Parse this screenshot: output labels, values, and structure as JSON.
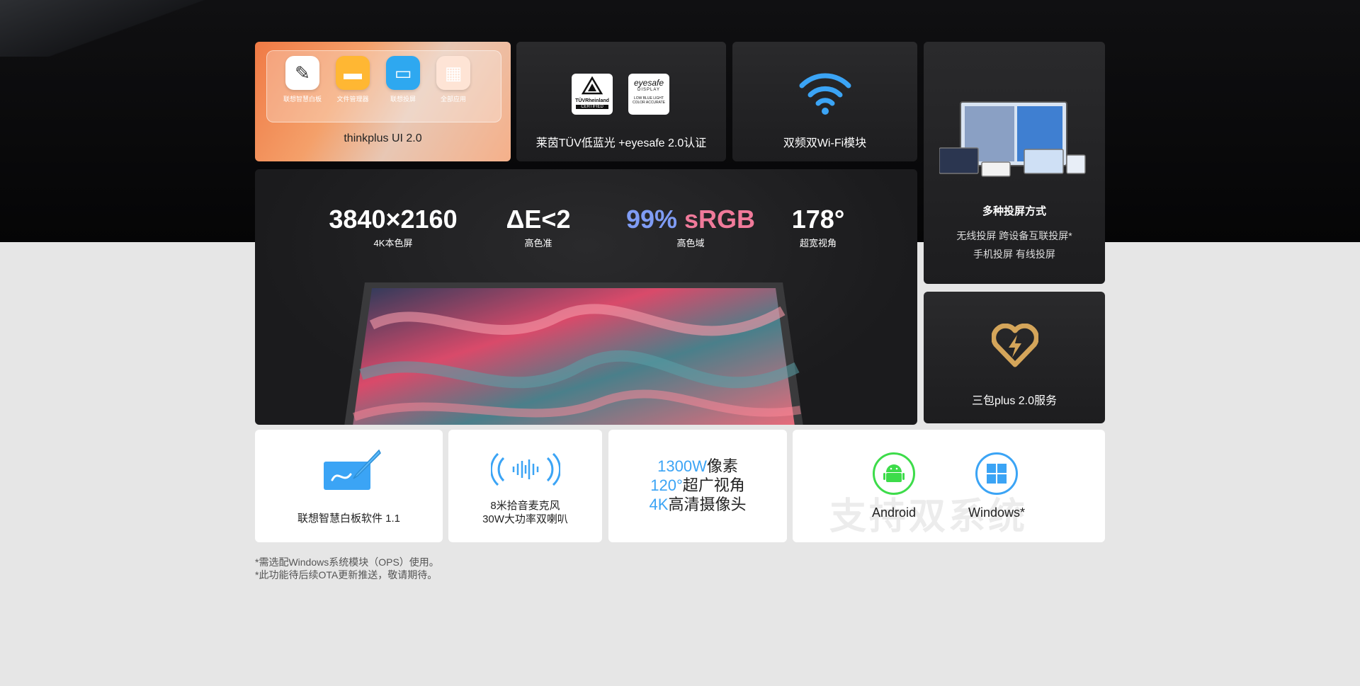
{
  "ui_card": {
    "apps": [
      {
        "label": "联想智慧白板",
        "icon": "pen-icon",
        "color": "#ffffff"
      },
      {
        "label": "文件管理器",
        "icon": "folder-icon",
        "color": "#ffb733"
      },
      {
        "label": "联想投屏",
        "icon": "cast-icon",
        "color": "#2ea8f0"
      },
      {
        "label": "全部应用",
        "icon": "apps-grid-icon",
        "color": "#ffd6c2"
      }
    ],
    "title": "thinkplus UI 2.0"
  },
  "cert_card": {
    "tuv_lines": [
      "TÜVRheinland",
      "CERTIFIED"
    ],
    "eyesafe_lines": [
      "eyesafe",
      "DISPLAY",
      "LOW BLUE LIGHT",
      "COLOR ACCURATE"
    ],
    "caption": "莱茵TÜV低蓝光 +eyesafe 2.0认证"
  },
  "wifi_card": {
    "caption": "双频双Wi-Fi模块",
    "accent": "#3ba4f5"
  },
  "projection_card": {
    "title": "多种投屏方式",
    "line1": "无线投屏 跨设备互联投屏*",
    "line2": "手机投屏 有线投屏"
  },
  "service_card": {
    "caption": "三包plus 2.0服务",
    "accent": "#d4a55a"
  },
  "specs": [
    {
      "value": "3840×2160",
      "label": "4K本色屏"
    },
    {
      "value": "ΔE<2",
      "label": "高色准"
    },
    {
      "value_a": "99%",
      "value_b": "sRGB",
      "label": "高色域"
    },
    {
      "value": "178°",
      "label": "超宽视角"
    }
  ],
  "features": {
    "whiteboard": "联想智慧白板软件 1.1",
    "mic_line1": "8米拾音麦克风",
    "mic_line2": "30W大功率双喇叭",
    "camera": [
      {
        "accent": "1300W",
        "text": "像素"
      },
      {
        "accent": "120°",
        "text": "超广视角"
      },
      {
        "accent": "4K",
        "text": "高清摄像头"
      }
    ],
    "dual_system_bg": "支持双系统",
    "android": "Android",
    "windows": "Windows*"
  },
  "footnotes": [
    "*需选配Windows系统模块（OPS）使用。",
    "*此功能待后续OTA更新推送，敬请期待。"
  ]
}
